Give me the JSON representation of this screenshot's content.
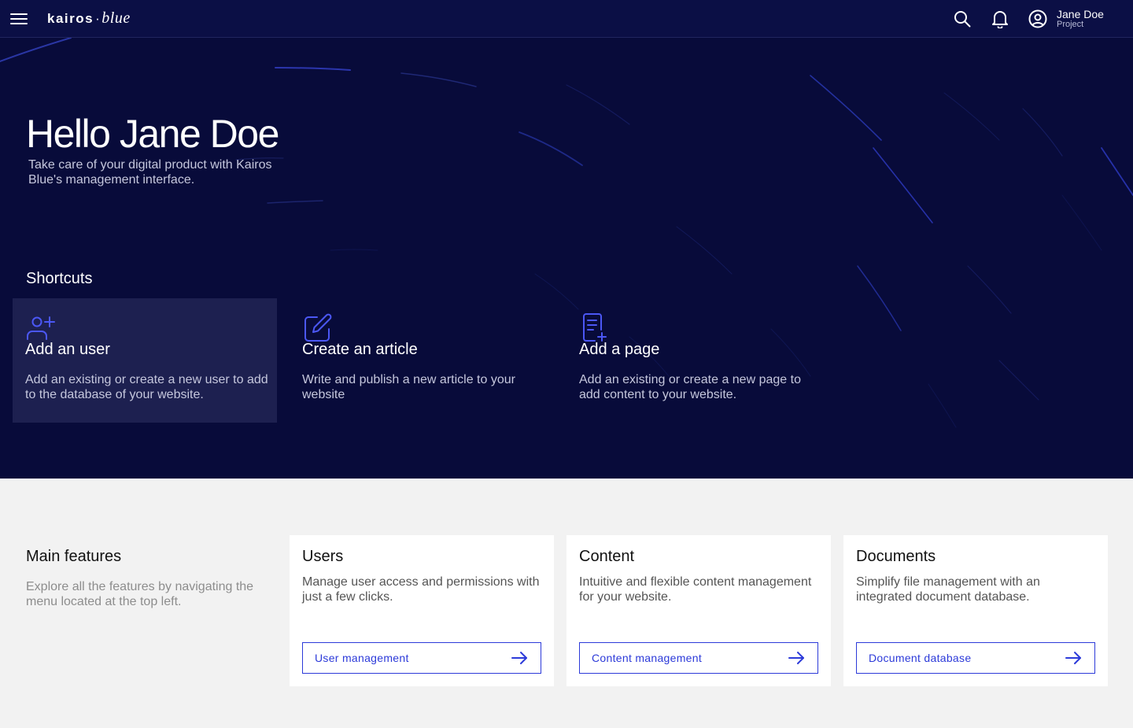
{
  "header": {
    "brand_main": "kairos",
    "brand_sep": "·",
    "brand_sub": "blue",
    "user_name": "Jane Doe",
    "user_role": "Project",
    "icons": [
      "menu-icon",
      "search-icon",
      "bell-icon",
      "user-circle-icon"
    ]
  },
  "hero": {
    "greeting": "Hello Jane Doe",
    "subtitle": "Take care of your digital product with Kairos Blue's management interface.",
    "shortcuts_title": "Shortcuts",
    "shortcuts": [
      {
        "icon": "add-user-icon",
        "title": "Add an user",
        "description": "Add an existing or create a new user to add to the database of your website."
      },
      {
        "icon": "edit-icon",
        "title": "Create an article",
        "description": "Write and publish a new article to your website"
      },
      {
        "icon": "add-page-icon",
        "title": "Add a page",
        "description": "Add an existing or create a new page to add content to your website."
      }
    ]
  },
  "features": {
    "title": "Main features",
    "description": "Explore all the features by navigating the menu located at the top left.",
    "cards": [
      {
        "title": "Users",
        "description": "Manage user access and permissions with just a few clicks.",
        "button": "User management"
      },
      {
        "title": "Content",
        "description": "Intuitive and flexible content management for your website.",
        "button": "Content management"
      },
      {
        "title": "Documents",
        "description": "Simplify file management with an integrated document database.",
        "button": "Document database"
      }
    ]
  },
  "colors": {
    "navy": "#0b0f45",
    "hero_bg": "#080b3a",
    "accent": "#2c3ad9",
    "icon_accent": "#4b57f5",
    "page_bg": "#f2f2f2"
  }
}
